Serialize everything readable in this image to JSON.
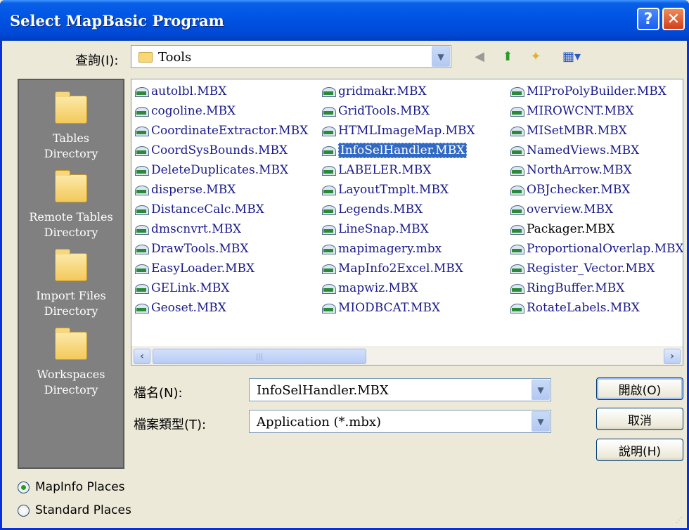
{
  "window": {
    "title": "Select MapBasic Program"
  },
  "lookin": {
    "label": "查詢(I):",
    "value": "Tools"
  },
  "places": [
    {
      "label": "Tables\nDirectory"
    },
    {
      "label": "Remote Tables\nDirectory"
    },
    {
      "label": "Import Files\nDirectory"
    },
    {
      "label": "Workspaces\nDirectory"
    }
  ],
  "files": {
    "col1": [
      "autolbl.MBX",
      "cogoline.MBX",
      "CoordinateExtractor.MBX",
      "CoordSysBounds.MBX",
      "DeleteDuplicates.MBX",
      "disperse.MBX",
      "DistanceCalc.MBX",
      "dmscnvrt.MBX",
      "DrawTools.MBX",
      "EasyLoader.MBX",
      "GELink.MBX",
      "Geoset.MBX"
    ],
    "col2": [
      "gridmakr.MBX",
      "GridTools.MBX",
      "HTMLImageMap.MBX",
      "InfoSelHandler.MBX",
      "LABELER.MBX",
      "LayoutTmplt.MBX",
      "Legends.MBX",
      "LineSnap.MBX",
      "mapimagery.mbx",
      "MapInfo2Excel.MBX",
      "mapwiz.MBX",
      "MIODBCAT.MBX"
    ],
    "col3": [
      "MIProPolyBuilder.MBX",
      "MIROWCNT.MBX",
      "MISetMBR.MBX",
      "NamedViews.MBX",
      "NorthArrow.MBX",
      "OBJchecker.MBX",
      "overview.MBX",
      "Packager.MBX",
      "ProportionalOverlap.MBX",
      "Register_Vector.MBX",
      "RingBuffer.MBX",
      "RotateLabels.MBX"
    ],
    "selected": "InfoSelHandler.MBX"
  },
  "filename": {
    "label": "檔名(N):",
    "value": "InfoSelHandler.MBX"
  },
  "filetype": {
    "label": "檔案類型(T):",
    "value": "Application (*.mbx)"
  },
  "buttons": {
    "open": "開啟(O)",
    "cancel": "取消",
    "help": "說明(H)"
  },
  "radios": {
    "mapinfo": "MapInfo Places",
    "standard": "Standard Places",
    "selected": "mapinfo"
  }
}
